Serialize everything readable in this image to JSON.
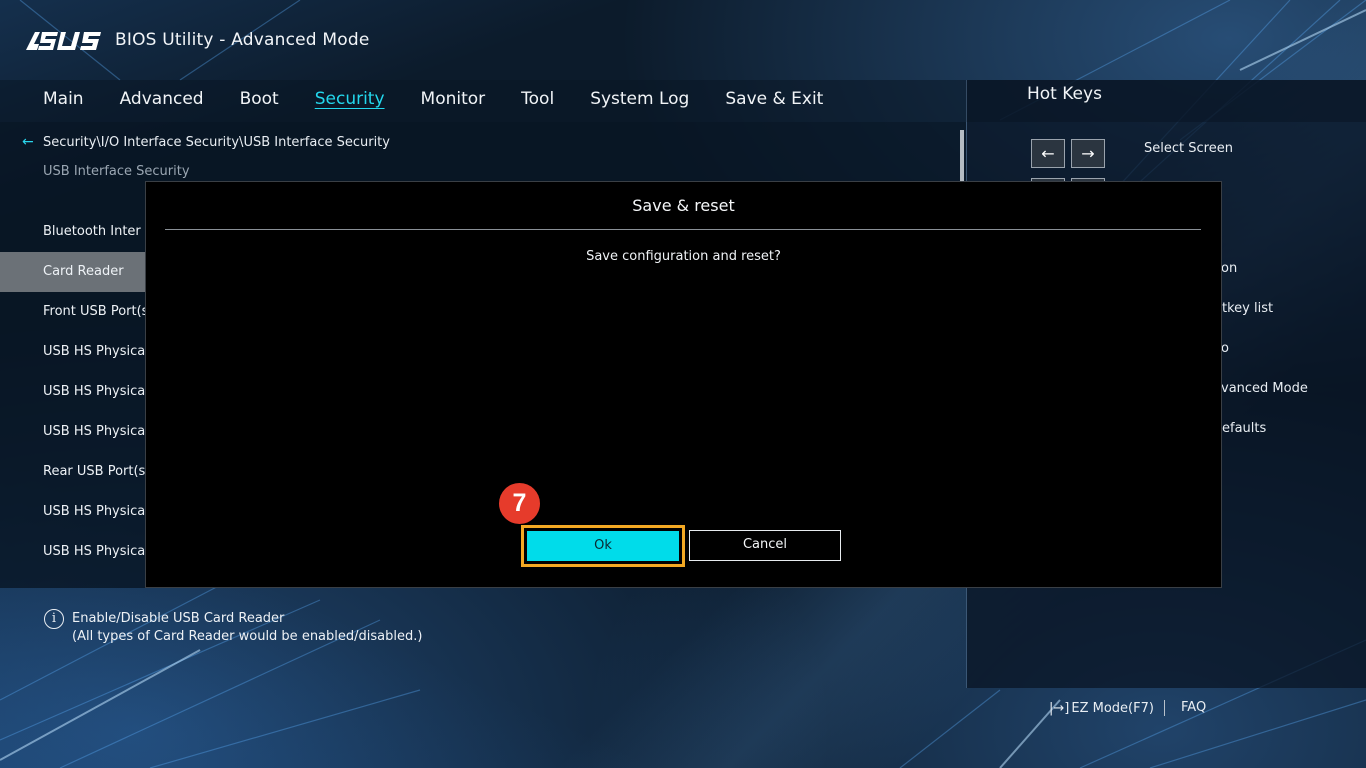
{
  "header": {
    "brand": "ASUS",
    "title": "BIOS Utility - Advanced Mode"
  },
  "nav": {
    "items": [
      "Main",
      "Advanced",
      "Boot",
      "Security",
      "Monitor",
      "Tool",
      "System Log",
      "Save & Exit"
    ],
    "active": "Security"
  },
  "breadcrumb": "Security\\I/O Interface Security\\USB Interface Security",
  "subtitle": "USB Interface Security",
  "settings": [
    "Bluetooth Inter",
    "Card Reader",
    "Front USB Port(s",
    "USB HS Physica",
    "USB HS Physica",
    "USB HS Physica",
    "Rear USB Port(s",
    "USB HS Physica",
    "USB HS Physica"
  ],
  "selected_setting": "Card Reader",
  "hotkeys": {
    "title": "Hot Keys",
    "select_screen_keys": [
      "←",
      "→"
    ],
    "labels": [
      "Select Screen",
      "on",
      "tkey list",
      "o",
      "vanced Mode",
      "efaults"
    ]
  },
  "help": {
    "line1": "Enable/Disable USB Card Reader",
    "line2": "(All types of Card Reader would be enabled/disabled.)"
  },
  "footer": {
    "ez_mode": "EZ Mode(F7)",
    "faq": "FAQ"
  },
  "dialog": {
    "title": "Save & reset",
    "message": "Save configuration and reset?",
    "ok_label": "Ok",
    "cancel_label": "Cancel"
  },
  "step_badge": "7",
  "colors": {
    "accent": "#00dcea",
    "highlight": "#f3a823",
    "badge": "#e63b2b"
  }
}
